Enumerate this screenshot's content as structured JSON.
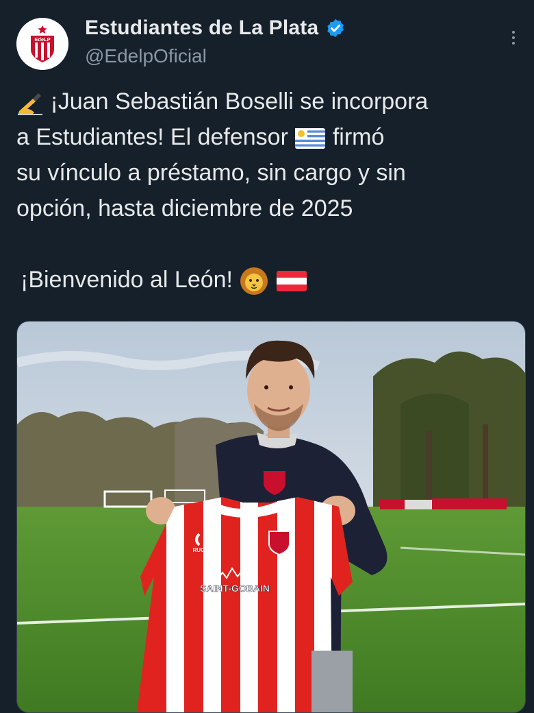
{
  "account": {
    "name": "Estudiantes de La Plata",
    "handle": "@EdelpOficial",
    "avatar_badge": "EdeLP",
    "verified": true
  },
  "tweet": {
    "lines": [
      "¡Juan Sebastián Boselli se incorpora",
      "a Estudiantes! El defensor",
      "firmó",
      "su vínculo a préstamo, sin cargo y sin",
      "opción, hasta diciembre de 2025",
      "¡Bienvenido al León!"
    ]
  },
  "media": {
    "jersey_sponsor": "SAINT-GOBAIN",
    "jersey_brand": "RUGE",
    "crest_text": "EdeLP"
  },
  "icons": {
    "verified": "verified-badge-icon",
    "more": "more-options-icon",
    "writing_hand": "writing-hand-emoji",
    "uruguay_flag": "uruguay-flag-emoji",
    "lion": "lion-face-emoji",
    "austria_flag": "red-white-flag-emoji"
  },
  "colors": {
    "background": "#15202b",
    "text": "#e7e9ea",
    "secondary_text": "#8b98a5",
    "verified": "#1d9bf0",
    "club_red": "#e0231f"
  }
}
